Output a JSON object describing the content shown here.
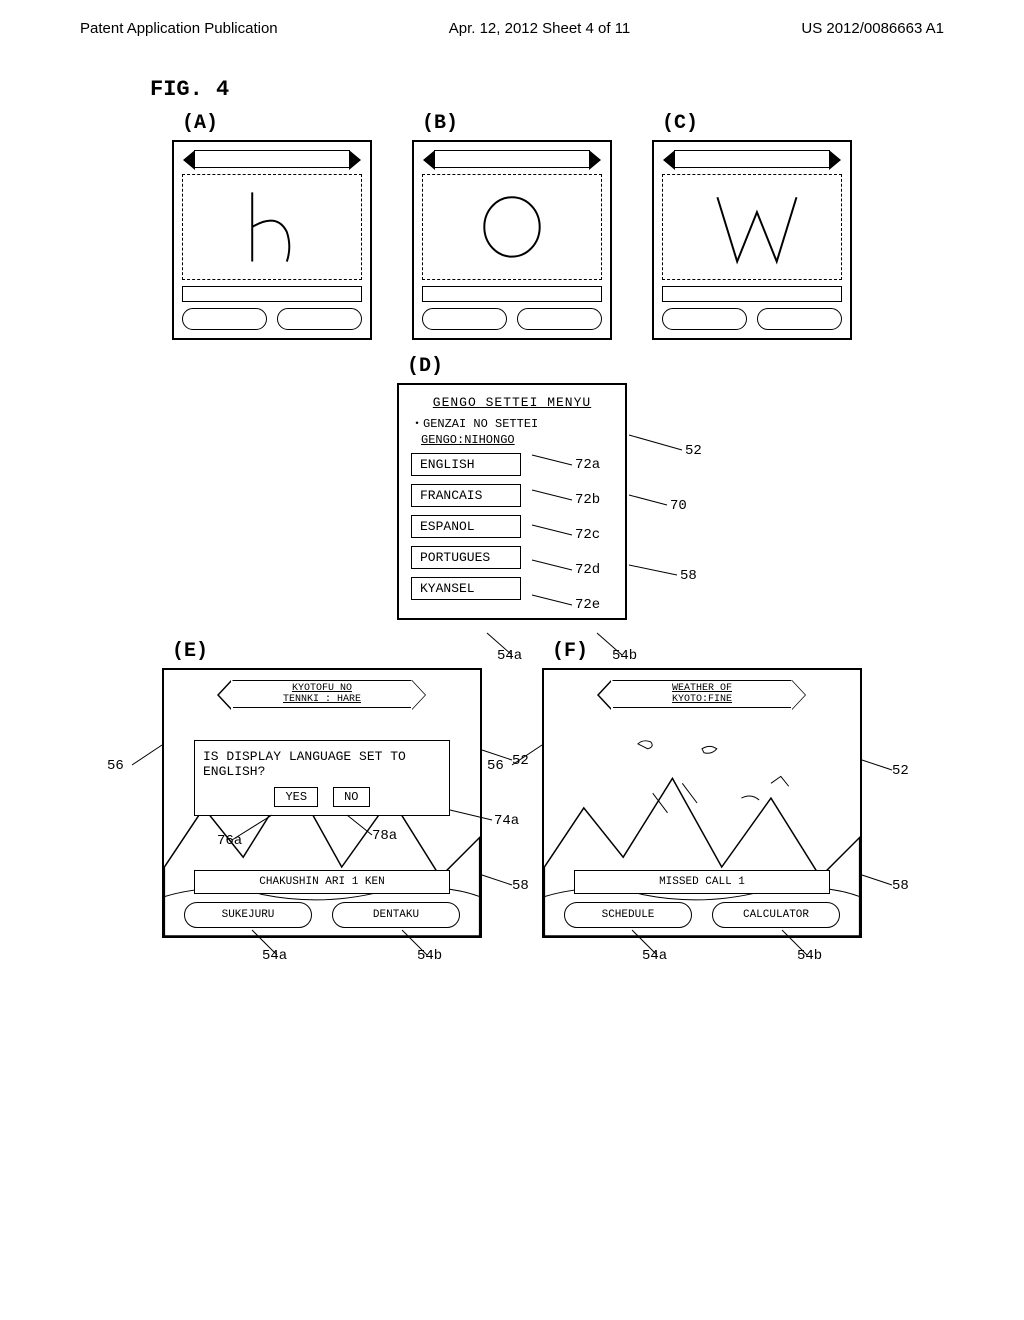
{
  "header": {
    "left": "Patent Application Publication",
    "center": "Apr. 12, 2012  Sheet 4 of 11",
    "right": "US 2012/0086663 A1"
  },
  "figure_label": "FIG. 4",
  "panels_top": {
    "a_label": "(A)",
    "b_label": "(B)",
    "c_label": "(C)"
  },
  "panel_d": {
    "label": "(D)",
    "title": "GENGO SETTEI MENYU",
    "subtitle": "・GENZAI NO SETTEI",
    "current": "GENGO:NIHONGO",
    "options": [
      "ENGLISH",
      "FRANCAIS",
      "ESPANOL",
      "PORTUGUES",
      "KYANSEL"
    ],
    "refs": {
      "r72a": "72a",
      "r72b": "72b",
      "r72c": "72c",
      "r72d": "72d",
      "r72e": "72e",
      "r52": "52",
      "r70": "70",
      "r58": "58",
      "r54a": "54a",
      "r54b": "54b"
    }
  },
  "panel_e": {
    "label": "(E)",
    "ticker": "KYOTOFU NO\nTENNKI : HARE",
    "dialog_text": "IS DISPLAY LANGUAGE SET TO ENGLISH?",
    "yes": "YES",
    "no": "NO",
    "pict": "CHAKUSHIN ARI   1 KEN",
    "btn_left": "SUKEJURU",
    "btn_right": "DENTAKU",
    "refs": {
      "r56": "56",
      "r52": "52",
      "r76a": "76a",
      "r78a": "78a",
      "r74a": "74a",
      "r58": "58",
      "r54a": "54a",
      "r54b": "54b"
    }
  },
  "panel_f": {
    "label": "(F)",
    "ticker": "WEATHER OF\nKYOTO:FINE",
    "pict": "MISSED CALL 1",
    "btn_left": "SCHEDULE",
    "btn_right": "CALCULATOR",
    "refs": {
      "r56": "56",
      "r52": "52",
      "r58": "58",
      "r54a": "54a",
      "r54b": "54b"
    }
  }
}
